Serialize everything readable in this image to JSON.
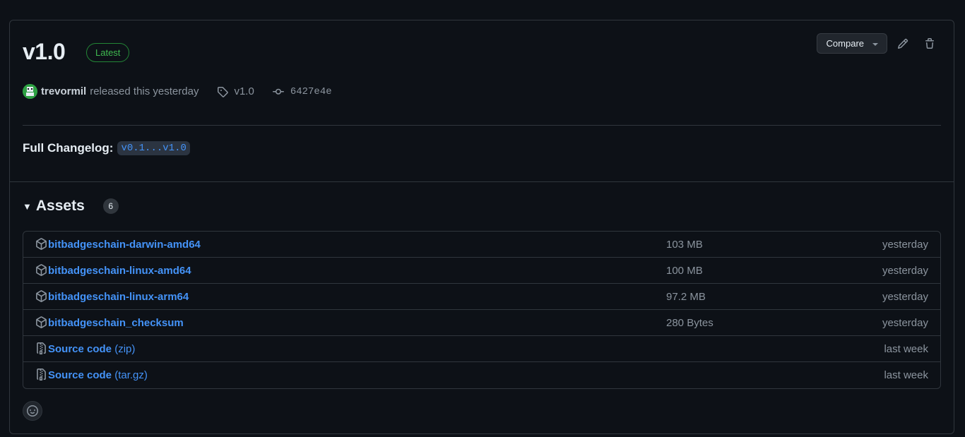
{
  "release": {
    "title": "v1.0",
    "badge": "Latest",
    "author": "trevormil",
    "released_text": "released this yesterday",
    "tag": "v1.0",
    "commit": "6427e4e",
    "changelog_label": "Full Changelog",
    "changelog_separator": ":",
    "changelog_link": "v0.1...v1.0"
  },
  "actions": {
    "compare_label": "Compare"
  },
  "assets": {
    "title": "Assets",
    "count": "6",
    "items": [
      {
        "name": "bitbadgeschain-darwin-amd64",
        "suffix": "",
        "size": "103 MB",
        "date": "yesterday",
        "icon": "package-icon"
      },
      {
        "name": "bitbadgeschain-linux-amd64",
        "suffix": "",
        "size": "100 MB",
        "date": "yesterday",
        "icon": "package-icon"
      },
      {
        "name": "bitbadgeschain-linux-arm64",
        "suffix": "",
        "size": "97.2 MB",
        "date": "yesterday",
        "icon": "package-icon"
      },
      {
        "name": "bitbadgeschain_checksum",
        "suffix": "",
        "size": "280 Bytes",
        "date": "yesterday",
        "icon": "package-icon"
      },
      {
        "name": "Source code",
        "suffix": "(zip)",
        "size": "",
        "date": "last week",
        "icon": "file-zip-icon"
      },
      {
        "name": "Source code",
        "suffix": "(tar.gz)",
        "size": "",
        "date": "last week",
        "icon": "file-zip-icon"
      }
    ]
  },
  "colors": {
    "background": "#0d1117",
    "border": "#30363d",
    "link": "#4493f8",
    "muted": "#8b949e",
    "success": "#3fb950"
  }
}
